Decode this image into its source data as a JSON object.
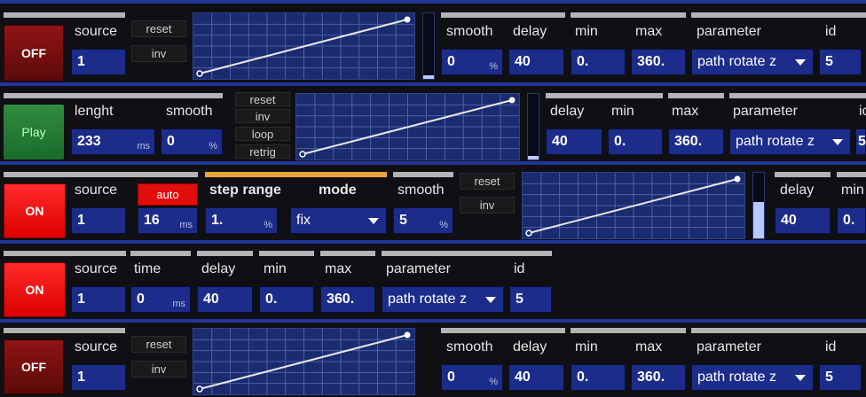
{
  "labels": {
    "source": "source",
    "smooth": "smooth",
    "delay": "delay",
    "min": "min",
    "max": "max",
    "parameter": "parameter",
    "id": "id",
    "lenght": "lenght",
    "time": "time",
    "step_range": "step range",
    "mode": "mode",
    "id_partial": "ic",
    "min_partial": "min"
  },
  "units": {
    "percent": "%",
    "ms": "ms"
  },
  "rows": [
    {
      "toggle": "OFF",
      "buttons": {
        "reset": "reset",
        "inv": "inv"
      },
      "source": "1",
      "smooth": "0",
      "delay": "40",
      "min": "0.",
      "max": "360.",
      "parameter": "path rotate z",
      "id": "5",
      "meter_level": 0.05
    },
    {
      "toggle": "Play",
      "buttons": {
        "reset": "reset",
        "inv": "inv",
        "loop": "loop",
        "retrig": "retrig"
      },
      "lenght": "233",
      "smooth": "0",
      "delay": "40",
      "min": "0.",
      "max": "360.",
      "parameter": "path rotate z",
      "id": "5",
      "meter_level": 0.05
    },
    {
      "toggle": "ON",
      "buttons": {
        "auto": "auto",
        "reset": "reset",
        "inv": "inv"
      },
      "source": "1",
      "auto_value": "16",
      "step_range": "1.",
      "mode": "fix",
      "smooth": "5",
      "delay": "40",
      "min": "0.",
      "meter_level": 0.55
    },
    {
      "toggle": "ON",
      "source": "1",
      "time": "0",
      "delay": "40",
      "min": "0.",
      "max": "360.",
      "parameter": "path rotate z",
      "id": "5"
    },
    {
      "toggle": "OFF",
      "buttons": {
        "reset": "reset",
        "inv": "inv"
      },
      "source": "1",
      "smooth": "0",
      "delay": "40",
      "min": "0.",
      "max": "360.",
      "parameter": "path rotate z",
      "id": "5"
    }
  ],
  "colors": {
    "panel_blue": "#1c2c8a",
    "separator": "#23359a",
    "on_red": "#ff1a1a",
    "off_red": "#7a0f0f",
    "play_green": "#2a8a3b"
  }
}
